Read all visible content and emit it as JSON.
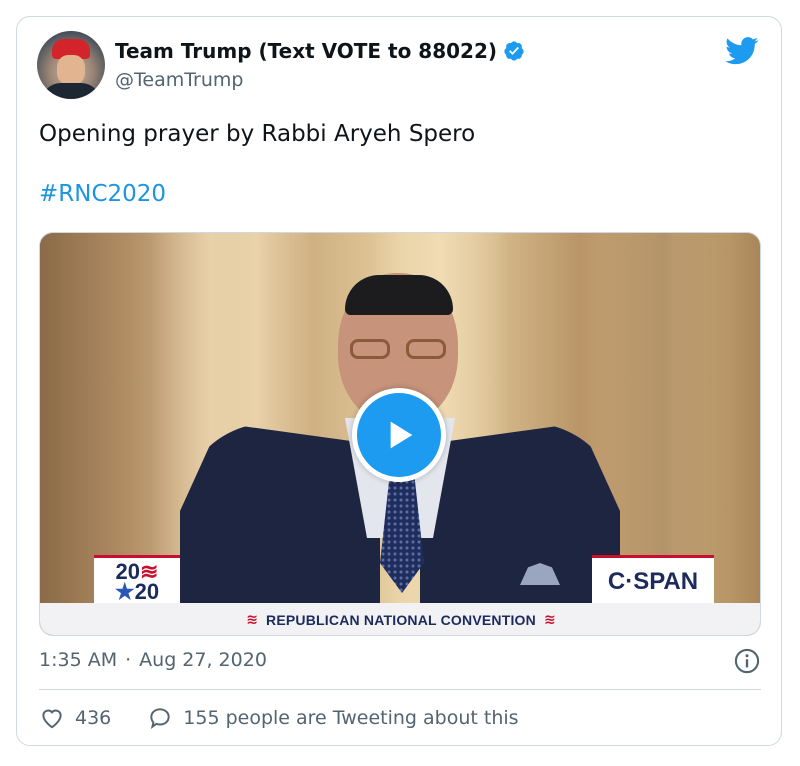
{
  "author": {
    "display_name": "Team Trump (Text VOTE to 88022)",
    "handle": "@TeamTrump",
    "avatar_icon": "profile-photo",
    "verified_icon": "verified-badge-icon"
  },
  "tweet": {
    "text": "Opening prayer by Rabbi Aryeh Spero",
    "hashtag": "#RNC2020"
  },
  "media": {
    "type": "video",
    "play_icon": "play-icon",
    "overlay": {
      "logo_left_line1": "20",
      "logo_left_stripes": "≋",
      "logo_left_star": "★",
      "logo_left_line2": "20",
      "logo_right": "C·SPAN",
      "banner_flag": "≋",
      "banner_text": "REPUBLICAN NATIONAL CONVENTION"
    }
  },
  "meta": {
    "time": "1:35 AM",
    "separator": "·",
    "date": "Aug 27, 2020"
  },
  "actions": {
    "likes_count": "436",
    "conversation_text": "155 people are Tweeting about this"
  },
  "colors": {
    "accent": "#1d9bf0",
    "hashtag": "#1b95e0",
    "secondary_text": "#536471",
    "border": "#cfd9de"
  }
}
